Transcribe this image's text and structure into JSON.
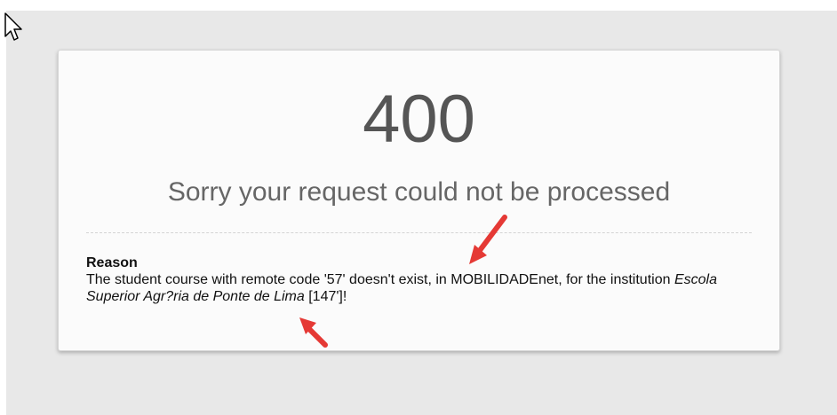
{
  "error": {
    "code": "400",
    "message": "Sorry your request could not be processed"
  },
  "reason": {
    "heading": "Reason",
    "text_before": "The student course with remote code '57' doesn't exist, in MOBILIDADEnet, for the institution ",
    "institution": "Escola Superior Agr?ria de Ponte de Lima",
    "text_after": " [147']!"
  },
  "colors": {
    "annotation_arrow": "#e53935"
  },
  "icons": {
    "cursor": "mouse-pointer-icon",
    "annotation": "red-arrow-icon"
  }
}
